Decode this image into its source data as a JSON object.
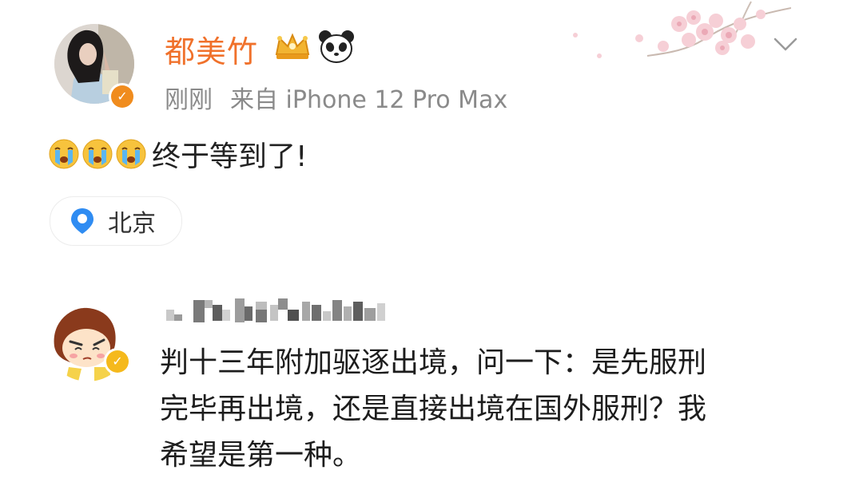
{
  "post": {
    "username": "都美竹",
    "time": "刚刚",
    "source": "来自 iPhone 12 Pro Max",
    "text": "终于等到了!",
    "location": "北京",
    "icons": {
      "avatar": "user-avatar",
      "verified": "verified-badge-icon",
      "crown": "crown-badge-icon",
      "panda": "panda-icon",
      "emoji": "crying-emoji-icon",
      "location": "location-pin-icon",
      "menu": "chevron-down-icon"
    }
  },
  "comment": {
    "lines": [
      "判十三年附加驱逐出境，问一下：是先服刑",
      "完毕再出境，还是直接出境在国外服刑？我",
      "希望是第一种。"
    ]
  },
  "colors": {
    "username": "#f0712b",
    "meta": "#8a8a8a",
    "verified_orange": "#f08c1e",
    "verified_yellow": "#f5b91c",
    "location_blue": "#2f8cf2"
  }
}
